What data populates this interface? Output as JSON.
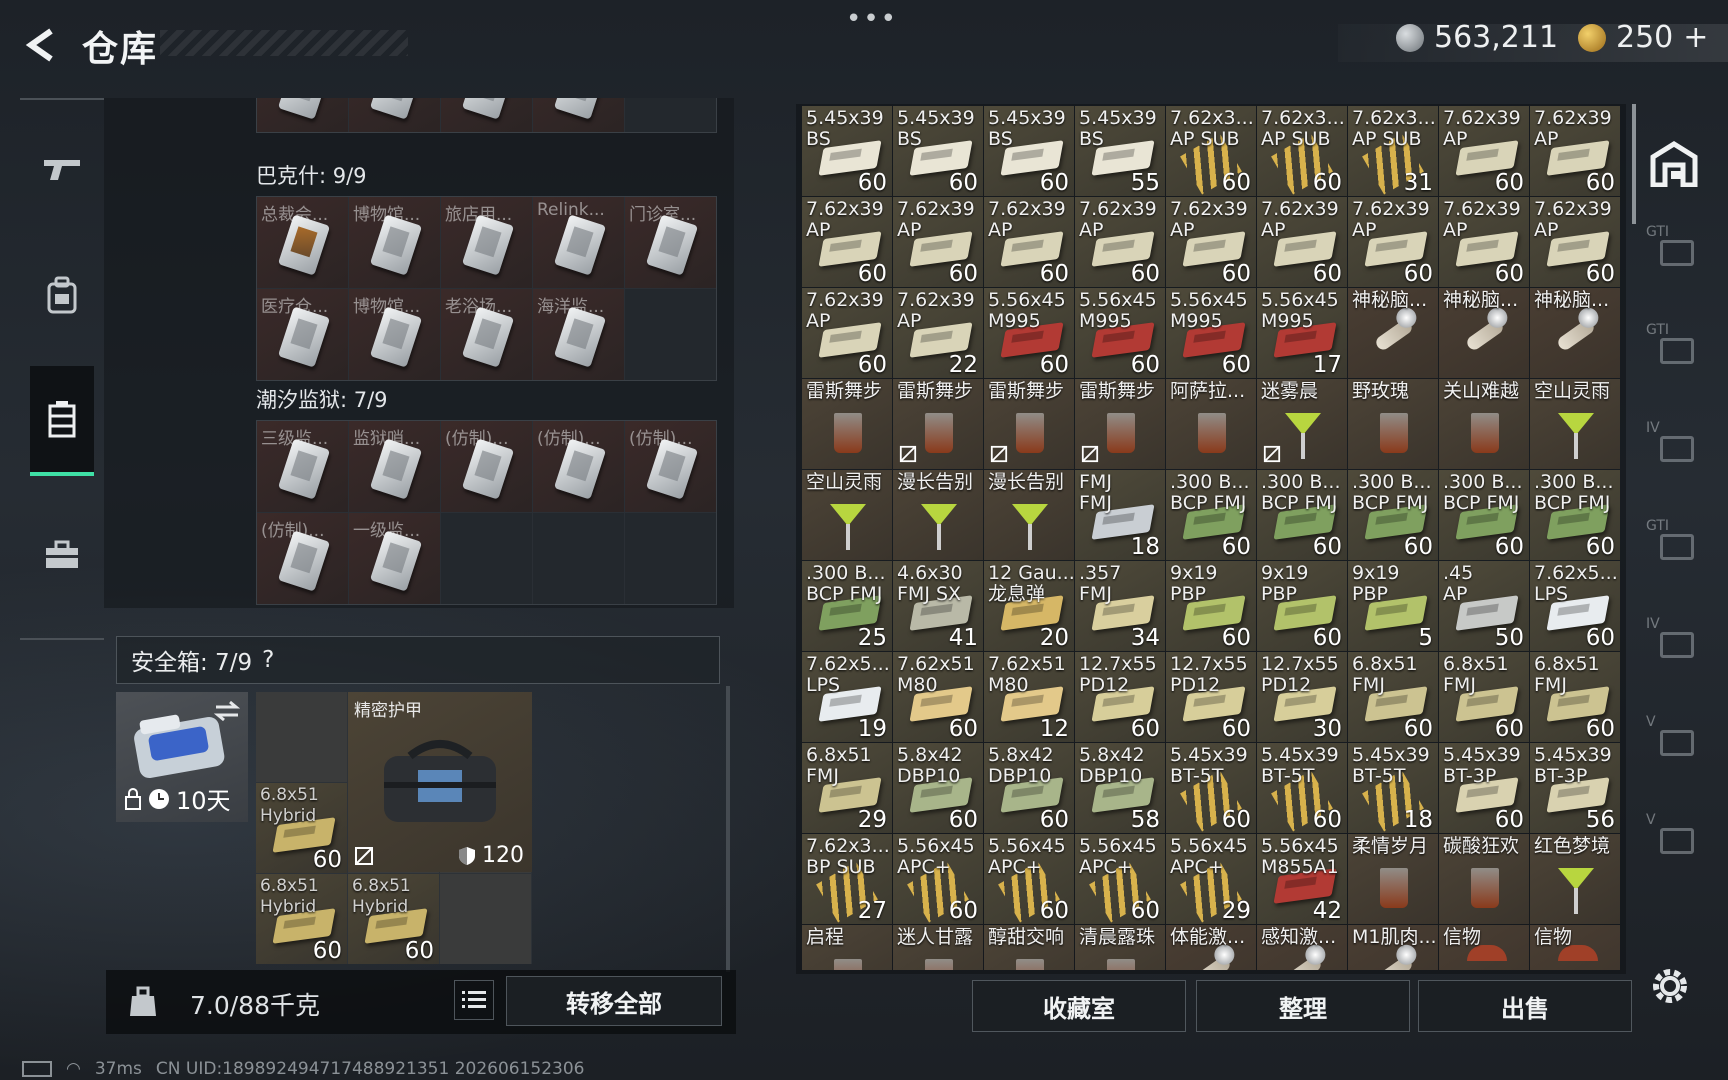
{
  "header": {
    "title": "仓库",
    "silver_amount": "563,211",
    "gold_amount": "250",
    "gold_plus": "+"
  },
  "nav": {
    "items": [
      "weapons",
      "equipment",
      "storage",
      "toolbox"
    ],
    "active_index": 2
  },
  "containers": [
    {
      "label": "巴克什: 9/9",
      "slots": [
        "总裁会...",
        "博物馆...",
        "旅店用...",
        "Relink...",
        "门诊室...",
        "医疗仓...",
        "博物馆...",
        "老浴场...",
        "海洋监..."
      ]
    },
    {
      "label": "潮汐监狱: 7/9",
      "slots": [
        "三级监...",
        "监狱哨...",
        "(仿制)...",
        "(仿制)...",
        "(仿制)...",
        "(仿制)...",
        "一级监..."
      ]
    }
  ],
  "secure_case": {
    "label": "安全箱: 7/9",
    "help": "?",
    "timer": "10天",
    "armor_name": "精密护甲",
    "armor_durability": "120",
    "ammo_slots": [
      {
        "name": "6.8x51\nHybrid",
        "qty": "60"
      },
      {
        "name": "6.8x51\nHybrid",
        "qty": "60"
      },
      {
        "name": "6.8x51\nHybrid",
        "qty": "60"
      }
    ]
  },
  "footer_left": {
    "weight": "7.0/88千克",
    "transfer_all": "转移全部"
  },
  "status": {
    "ping": "37ms",
    "uid": "CN UID:189892494717488921351 202606152306"
  },
  "warehouse": {
    "items": [
      {
        "name": "5.45x39\nBS",
        "qty": "60",
        "type": "ammo",
        "color": "#e9e5d5"
      },
      {
        "name": "5.45x39\nBS",
        "qty": "60",
        "type": "ammo",
        "color": "#e9e5d5"
      },
      {
        "name": "5.45x39\nBS",
        "qty": "60",
        "type": "ammo",
        "color": "#e9e5d5"
      },
      {
        "name": "5.45x39\nBS",
        "qty": "55",
        "type": "ammo",
        "color": "#e9e5d5"
      },
      {
        "name": "7.62x3...\nAP SUB",
        "qty": "60",
        "type": "bullets",
        "color": "#3d6b3a"
      },
      {
        "name": "7.62x3...\nAP SUB",
        "qty": "60",
        "type": "bullets",
        "color": "#3d6b3a"
      },
      {
        "name": "7.62x3...\nAP SUB",
        "qty": "31",
        "type": "bullets",
        "color": "#3d6b3a"
      },
      {
        "name": "7.62x39\nAP",
        "qty": "60",
        "type": "ammo",
        "color": "#d9d4b8"
      },
      {
        "name": "7.62x39\nAP",
        "qty": "60",
        "type": "ammo",
        "color": "#d9d4b8"
      },
      {
        "name": "7.62x39\nAP",
        "qty": "60",
        "type": "ammo",
        "color": "#d9d4b8"
      },
      {
        "name": "7.62x39\nAP",
        "qty": "60",
        "type": "ammo",
        "color": "#d9d4b8"
      },
      {
        "name": "7.62x39\nAP",
        "qty": "60",
        "type": "ammo",
        "color": "#d9d4b8"
      },
      {
        "name": "7.62x39\nAP",
        "qty": "60",
        "type": "ammo",
        "color": "#d9d4b8"
      },
      {
        "name": "7.62x39\nAP",
        "qty": "60",
        "type": "ammo",
        "color": "#d9d4b8"
      },
      {
        "name": "7.62x39\nAP",
        "qty": "60",
        "type": "ammo",
        "color": "#d9d4b8"
      },
      {
        "name": "7.62x39\nAP",
        "qty": "60",
        "type": "ammo",
        "color": "#d9d4b8"
      },
      {
        "name": "7.62x39\nAP",
        "qty": "60",
        "type": "ammo",
        "color": "#d9d4b8"
      },
      {
        "name": "7.62x39\nAP",
        "qty": "60",
        "type": "ammo",
        "color": "#d9d4b8"
      },
      {
        "name": "7.62x39\nAP",
        "qty": "60",
        "type": "ammo",
        "color": "#d9d4b8"
      },
      {
        "name": "7.62x39\nAP",
        "qty": "22",
        "type": "ammo",
        "color": "#d9d4b8"
      },
      {
        "name": "5.56x45\nM995",
        "qty": "60",
        "type": "ammo",
        "color": "#b23a34"
      },
      {
        "name": "5.56x45\nM995",
        "qty": "60",
        "type": "ammo",
        "color": "#b23a34"
      },
      {
        "name": "5.56x45\nM995",
        "qty": "60",
        "type": "ammo",
        "color": "#b23a34"
      },
      {
        "name": "5.56x45\nM995",
        "qty": "17",
        "type": "ammo",
        "color": "#b23a34"
      },
      {
        "name": "神秘脑...",
        "qty": "",
        "type": "vial",
        "color": ""
      },
      {
        "name": "神秘脑...",
        "qty": "",
        "type": "vial",
        "color": ""
      },
      {
        "name": "神秘脑...",
        "qty": "",
        "type": "vial",
        "color": ""
      },
      {
        "name": "雷斯舞步",
        "qty": "",
        "type": "glass",
        "color": "",
        "nobind": false
      },
      {
        "name": "雷斯舞步",
        "qty": "",
        "type": "glass",
        "color": "",
        "nobind": true
      },
      {
        "name": "雷斯舞步",
        "qty": "",
        "type": "glass",
        "color": "",
        "nobind": true
      },
      {
        "name": "雷斯舞步",
        "qty": "",
        "type": "glass",
        "color": "",
        "nobind": true
      },
      {
        "name": "阿萨拉...",
        "qty": "",
        "type": "glass",
        "color": "",
        "nobind": false
      },
      {
        "name": "迷雾晨",
        "qty": "",
        "type": "cocktail",
        "color": "",
        "nobind": true
      },
      {
        "name": "野玫瑰",
        "qty": "",
        "type": "glass",
        "color": "",
        "nobind": false
      },
      {
        "name": "关山难越",
        "qty": "",
        "type": "glass",
        "color": "",
        "nobind": false
      },
      {
        "name": "空山灵雨",
        "qty": "",
        "type": "cocktail",
        "color": "",
        "nobind": false
      },
      {
        "name": "空山灵雨",
        "qty": "",
        "type": "cocktail",
        "color": ""
      },
      {
        "name": "漫长告别",
        "qty": "",
        "type": "cocktail",
        "color": ""
      },
      {
        "name": "漫长告别",
        "qty": "",
        "type": "cocktail",
        "color": ""
      },
      {
        "name": "FMJ\nFMJ",
        "qty": "18",
        "type": "ammo",
        "color": "#c9ced3"
      },
      {
        "name": ".300 B...\nBCP FMJ",
        "qty": "60",
        "type": "ammo",
        "color": "#7fa05f"
      },
      {
        "name": ".300 B...\nBCP FMJ",
        "qty": "60",
        "type": "ammo",
        "color": "#7fa05f"
      },
      {
        "name": ".300 B...\nBCP FMJ",
        "qty": "60",
        "type": "ammo",
        "color": "#7fa05f"
      },
      {
        "name": ".300 B...\nBCP FMJ",
        "qty": "60",
        "type": "ammo",
        "color": "#7fa05f"
      },
      {
        "name": ".300 B...\nBCP FMJ",
        "qty": "60",
        "type": "ammo",
        "color": "#7fa05f"
      },
      {
        "name": ".300 B...\nBCP FMJ",
        "qty": "25",
        "type": "ammo",
        "color": "#7fa05f"
      },
      {
        "name": "4.6x30\nFMJ SX",
        "qty": "41",
        "type": "ammo",
        "color": "#b9b9a7"
      },
      {
        "name": "12 Gau...\n龙息弹",
        "qty": "20",
        "type": "ammo",
        "color": "#d6b766"
      },
      {
        "name": ".357\nFMJ",
        "qty": "34",
        "type": "ammo",
        "color": "#d9cf9e"
      },
      {
        "name": "9x19\nPBP",
        "qty": "60",
        "type": "ammo",
        "color": "#b2c26a"
      },
      {
        "name": "9x19\nPBP",
        "qty": "60",
        "type": "ammo",
        "color": "#b2c26a"
      },
      {
        "name": "9x19\nPBP",
        "qty": "5",
        "type": "ammo",
        "color": "#b2c26a"
      },
      {
        "name": ".45\nAP",
        "qty": "50",
        "type": "ammo",
        "color": "#c7c9c7"
      },
      {
        "name": "7.62x5...\nLPS",
        "qty": "60",
        "type": "ammo",
        "color": "#e8ecef"
      },
      {
        "name": "7.62x5...\nLPS",
        "qty": "19",
        "type": "ammo",
        "color": "#e8ecef"
      },
      {
        "name": "7.62x51\nM80",
        "qty": "60",
        "type": "ammo",
        "color": "#e3c98a"
      },
      {
        "name": "7.62x51\nM80",
        "qty": "12",
        "type": "ammo",
        "color": "#e3c98a"
      },
      {
        "name": "12.7x55\nPD12",
        "qty": "60",
        "type": "ammo",
        "color": "#d7ce9a"
      },
      {
        "name": "12.7x55\nPD12",
        "qty": "60",
        "type": "ammo",
        "color": "#d7ce9a"
      },
      {
        "name": "12.7x55\nPD12",
        "qty": "30",
        "type": "ammo",
        "color": "#d7ce9a"
      },
      {
        "name": "6.8x51\nFMJ",
        "qty": "60",
        "type": "ammo",
        "color": "#ccc391"
      },
      {
        "name": "6.8x51\nFMJ",
        "qty": "60",
        "type": "ammo",
        "color": "#ccc391"
      },
      {
        "name": "6.8x51\nFMJ",
        "qty": "60",
        "type": "ammo",
        "color": "#ccc391"
      },
      {
        "name": "6.8x51\nFMJ",
        "qty": "29",
        "type": "ammo",
        "color": "#ccc391"
      },
      {
        "name": "5.8x42\nDBP10",
        "qty": "60",
        "type": "ammo",
        "color": "#a8b58a"
      },
      {
        "name": "5.8x42\nDBP10",
        "qty": "60",
        "type": "ammo",
        "color": "#a8b58a"
      },
      {
        "name": "5.8x42\nDBP10",
        "qty": "58",
        "type": "ammo",
        "color": "#a8b58a"
      },
      {
        "name": "5.45x39\nBT-5T",
        "qty": "60",
        "type": "bullets",
        "color": "#3d6b3a"
      },
      {
        "name": "5.45x39\nBT-5T",
        "qty": "60",
        "type": "bullets",
        "color": "#3d6b3a"
      },
      {
        "name": "5.45x39\nBT-5T",
        "qty": "18",
        "type": "bullets",
        "color": "#3d6b3a"
      },
      {
        "name": "5.45x39\nBT-3P",
        "qty": "60",
        "type": "ammo",
        "color": "#d9d2b0"
      },
      {
        "name": "5.45x39\nBT-3P",
        "qty": "56",
        "type": "ammo",
        "color": "#d9d2b0"
      },
      {
        "name": "7.62x3...\nBP SUB",
        "qty": "27",
        "type": "bullets",
        "color": "#3d6b3a"
      },
      {
        "name": "5.56x45\nAPC+",
        "qty": "60",
        "type": "bullets",
        "color": "#3d6b3a"
      },
      {
        "name": "5.56x45\nAPC+",
        "qty": "60",
        "type": "bullets",
        "color": "#3d6b3a"
      },
      {
        "name": "5.56x45\nAPC+",
        "qty": "60",
        "type": "bullets",
        "color": "#3d6b3a"
      },
      {
        "name": "5.56x45\nAPC+",
        "qty": "29",
        "type": "bullets",
        "color": "#3d6b3a"
      },
      {
        "name": "5.56x45\nM855A1",
        "qty": "42",
        "type": "ammo",
        "color": "#b23a34"
      },
      {
        "name": "柔情岁月",
        "qty": "",
        "type": "glass",
        "color": ""
      },
      {
        "name": "碳酸狂欢",
        "qty": "",
        "type": "glass",
        "color": ""
      },
      {
        "name": "红色梦境",
        "qty": "",
        "type": "cocktail",
        "color": ""
      },
      {
        "name": "启程",
        "qty": "",
        "type": "glass",
        "color": ""
      },
      {
        "name": "迷人甘露",
        "qty": "",
        "type": "glass",
        "color": ""
      },
      {
        "name": "醇甜交响",
        "qty": "",
        "type": "glass",
        "color": ""
      },
      {
        "name": "清晨露珠",
        "qty": "",
        "type": "glass",
        "color": ""
      },
      {
        "name": "体能激...",
        "qty": "",
        "type": "vial",
        "color": ""
      },
      {
        "name": "感知激...",
        "qty": "",
        "type": "vial",
        "color": ""
      },
      {
        "name": "M1肌肉...",
        "qty": "",
        "type": "vial",
        "color": ""
      },
      {
        "name": "信物",
        "qty": "",
        "type": "mushroom",
        "color": ""
      },
      {
        "name": "信物",
        "qty": "",
        "type": "mushroom",
        "color": ""
      }
    ]
  },
  "right_rail": [
    "GTI",
    "GTI",
    "IV",
    "GTI",
    "IV",
    "V",
    "V"
  ],
  "bottom_buttons": {
    "collection": "收藏室",
    "organize": "整理",
    "sell": "出售"
  },
  "colors": {
    "accent": "#3fe0a6"
  }
}
